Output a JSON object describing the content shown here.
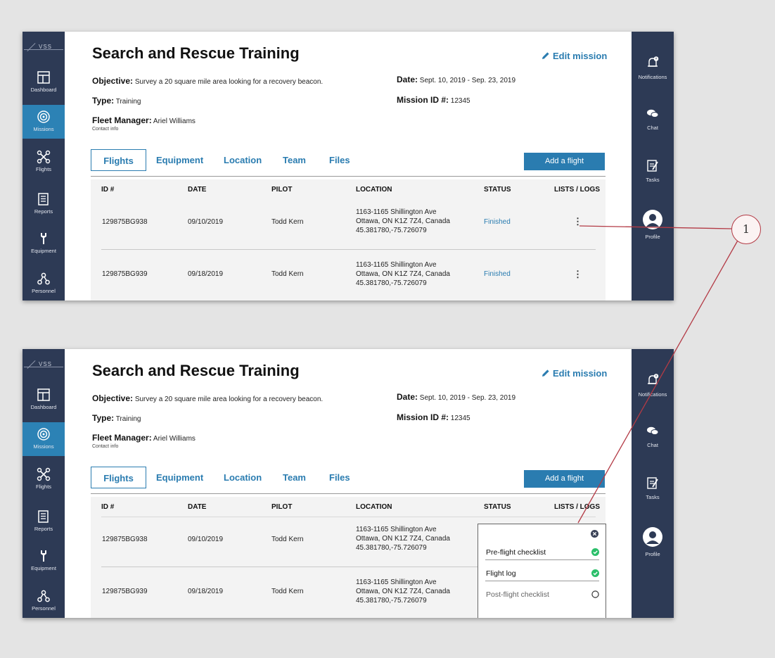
{
  "logo": {
    "text": "VSS"
  },
  "left_nav": [
    {
      "label": "Dashboard",
      "icon": "dashboard-icon"
    },
    {
      "label": "Missions",
      "icon": "target-icon",
      "active": true
    },
    {
      "label": "Flights",
      "icon": "drone-icon"
    },
    {
      "label": "Reports",
      "icon": "reports-icon"
    },
    {
      "label": "Equipment",
      "icon": "wrench-icon"
    },
    {
      "label": "Personnel",
      "icon": "personnel-icon"
    }
  ],
  "right_nav": [
    {
      "label": "Notifications",
      "icon": "bell-icon"
    },
    {
      "label": "Chat",
      "icon": "chat-icon"
    },
    {
      "label": "Tasks",
      "icon": "tasks-icon"
    },
    {
      "label": "Profile",
      "icon": "avatar-icon"
    }
  ],
  "mission": {
    "title": "Search and Rescue Training",
    "edit_label": "Edit mission",
    "objective_label": "Objective:",
    "objective": "Survey a 20 square mile area looking for a recovery beacon.",
    "type_label": "Type:",
    "type": "Training",
    "fleet_manager_label": "Fleet Manager:",
    "fleet_manager": "Ariel Williams",
    "contact_info": "Contact info",
    "date_label": "Date:",
    "date": "Sept. 10, 2019 - Sep. 23, 2019",
    "mission_id_label": "Mission ID #:",
    "mission_id": "12345"
  },
  "tabs": [
    "Flights",
    "Equipment",
    "Location",
    "Team",
    "Files"
  ],
  "active_tab": "Flights",
  "add_flight_label": "Add a flight",
  "table": {
    "headers": [
      "ID #",
      "DATE",
      "PILOT",
      "LOCATION",
      "STATUS",
      "LISTS / LOGS"
    ],
    "rows": [
      {
        "id": "129875BG938",
        "date": "09/10/2019",
        "pilot": "Todd Kern",
        "loc1": "1163-1165 Shillington Ave",
        "loc2": "Ottawa, ON K1Z 7Z4, Canada",
        "loc3": "45.381780,-75.726079",
        "status": "Finished",
        "menu": "⋮"
      },
      {
        "id": "129875BG939",
        "date": "09/18/2019",
        "pilot": "Todd Kern",
        "loc1": "1163-1165 Shillington Ave",
        "loc2": "Ottawa, ON K1Z 7Z4, Canada",
        "loc3": "45.381780,-75.726079",
        "status": "Finished",
        "menu": "⋮"
      }
    ]
  },
  "popup": {
    "items": [
      {
        "label": "Pre-flight checklist",
        "done": true
      },
      {
        "label": "Flight log",
        "done": true
      },
      {
        "label": "Post-flight checklist",
        "done": false
      }
    ]
  },
  "callout": {
    "number": "1"
  },
  "colors": {
    "nav_bg": "#2d3a55",
    "accent": "#2a7cb0",
    "check_green": "#2bbf6a",
    "callout_red": "#b33a45"
  }
}
